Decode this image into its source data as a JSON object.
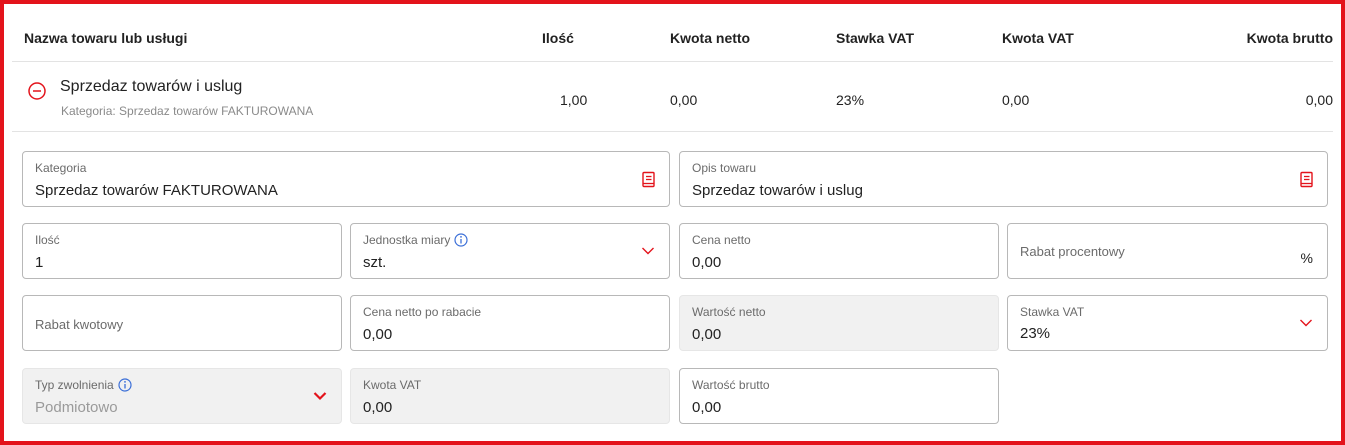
{
  "colors": {
    "accent": "#e3131b",
    "info": "#3b6fd8"
  },
  "table": {
    "headers": {
      "name": "Nazwa towaru lub usługi",
      "qty": "Ilość",
      "net": "Kwota netto",
      "vat_rate": "Stawka VAT",
      "vat_amount": "Kwota VAT",
      "gross": "Kwota brutto"
    },
    "row": {
      "title": "Sprzedaz towarów i uslug",
      "subtitle": "Kategoria: Sprzedaz towarów FAKTUROWANA",
      "qty": "1,00",
      "net": "0,00",
      "vat_rate": "23%",
      "vat_amount": "0,00",
      "gross": "0,00"
    }
  },
  "form": {
    "kategoria": {
      "label": "Kategoria",
      "value": "Sprzedaz towarów FAKTUROWANA",
      "icon": "book-icon"
    },
    "opis": {
      "label": "Opis towaru",
      "value": "Sprzedaz towarów i uslug",
      "icon": "book-icon"
    },
    "ilosc": {
      "label": "Ilość",
      "value": "1"
    },
    "jednostka": {
      "label": "Jednostka miary",
      "value": "szt.",
      "icon": "info-icon"
    },
    "cena_netto": {
      "label": "Cena netto",
      "value": "0,00"
    },
    "rabat_proc": {
      "label": "Rabat procentowy",
      "suffix": "%"
    },
    "rabat_kwot": {
      "label": "Rabat kwotowy"
    },
    "cena_po_rabacie": {
      "label": "Cena netto po rabacie",
      "value": "0,00"
    },
    "wartosc_netto": {
      "label": "Wartość netto",
      "value": "0,00"
    },
    "stawka_vat": {
      "label": "Stawka VAT",
      "value": "23%"
    },
    "typ_zwolnienia": {
      "label": "Typ zwolnienia",
      "value": "Podmiotowo",
      "icon": "info-icon"
    },
    "kwota_vat": {
      "label": "Kwota VAT",
      "value": "0,00"
    },
    "wartosc_brutto": {
      "label": "Wartość brutto",
      "value": "0,00"
    }
  }
}
